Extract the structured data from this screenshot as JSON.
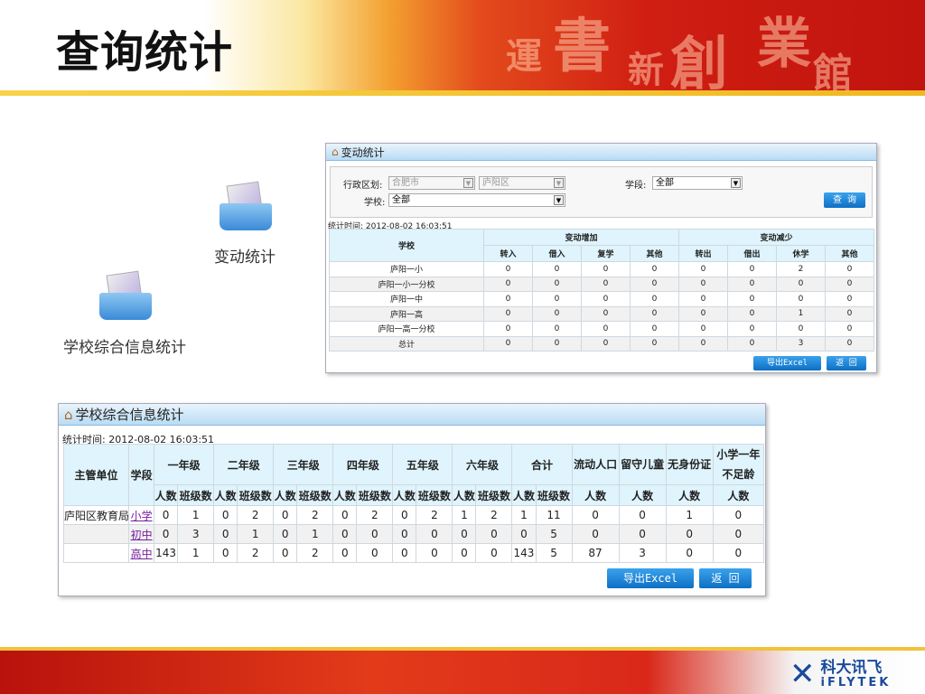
{
  "slide": {
    "title": "查询统计",
    "deco_chars": [
      "運",
      "書",
      "新",
      "創",
      "業",
      "館"
    ],
    "logo": {
      "cn": "科大讯飞",
      "en": "iFLYTEK"
    }
  },
  "icons": [
    {
      "label": "变动统计"
    },
    {
      "label": "学校综合信息统计"
    }
  ],
  "change_panel": {
    "title": "变动统计",
    "region_label": "行政区划:",
    "city": "合肥市",
    "district": "庐阳区",
    "stage_label": "学段:",
    "stage": "全部",
    "school_label": "学校:",
    "school": "全部",
    "query": "查 询",
    "time": "统计时间: 2012-08-02 16:03:51",
    "head_school": "学校",
    "group_inc": "变动增加",
    "group_dec": "变动减少",
    "cols": [
      "转入",
      "借入",
      "复学",
      "其他",
      "转出",
      "借出",
      "休学",
      "其他"
    ],
    "rows": [
      [
        "庐阳一小",
        "0",
        "0",
        "0",
        "0",
        "0",
        "0",
        "2",
        "0"
      ],
      [
        "庐阳一小一分校",
        "0",
        "0",
        "0",
        "0",
        "0",
        "0",
        "0",
        "0"
      ],
      [
        "庐阳一中",
        "0",
        "0",
        "0",
        "0",
        "0",
        "0",
        "0",
        "0"
      ],
      [
        "庐阳一高",
        "0",
        "0",
        "0",
        "0",
        "0",
        "0",
        "1",
        "0"
      ],
      [
        "庐阳一高一分校",
        "0",
        "0",
        "0",
        "0",
        "0",
        "0",
        "0",
        "0"
      ],
      [
        "总计",
        "0",
        "0",
        "0",
        "0",
        "0",
        "0",
        "3",
        "0"
      ]
    ],
    "export": "导出Excel",
    "back": "返 回"
  },
  "school_panel": {
    "title": "学校综合信息统计",
    "time": "统计时间: 2012-08-02 16:03:51",
    "h_unit": "主管单位",
    "h_stage": "学段",
    "grades": [
      "一年级",
      "二年级",
      "三年级",
      "四年级",
      "五年级",
      "六年级",
      "合计"
    ],
    "sub_count": "人数",
    "sub_class": "班级数",
    "extra": [
      "流动人口",
      "留守儿童",
      "无身份证",
      "小学一年\n不足龄"
    ],
    "rows": [
      [
        "庐阳区教育局",
        "小学",
        "0",
        "1",
        "0",
        "2",
        "0",
        "2",
        "0",
        "2",
        "0",
        "2",
        "1",
        "2",
        "1",
        "11",
        "0",
        "0",
        "1",
        "0"
      ],
      [
        "",
        "初中",
        "0",
        "3",
        "0",
        "1",
        "0",
        "1",
        "0",
        "0",
        "0",
        "0",
        "0",
        "0",
        "0",
        "5",
        "0",
        "0",
        "0",
        "0"
      ],
      [
        "",
        "高中",
        "143",
        "1",
        "0",
        "2",
        "0",
        "2",
        "0",
        "0",
        "0",
        "0",
        "0",
        "0",
        "143",
        "5",
        "87",
        "3",
        "0",
        "0"
      ]
    ],
    "export": "导出Excel",
    "back": "返 回"
  }
}
